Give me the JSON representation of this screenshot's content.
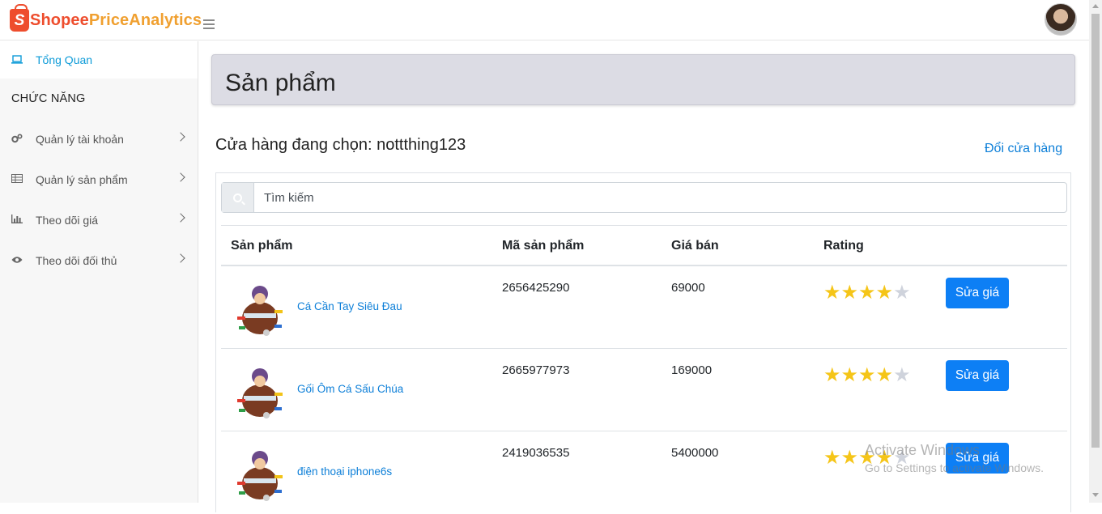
{
  "app": {
    "logo_part1": "Shopee",
    "logo_part2": "PriceAnalytics",
    "logo_letter": "S"
  },
  "sidebar": {
    "overview_label": "Tổng Quan",
    "section_header": "CHỨC NĂNG",
    "items": [
      {
        "label": "Quản lý tài khoản",
        "icon": "gears-icon"
      },
      {
        "label": "Quản lý sản phẩm",
        "icon": "table-icon"
      },
      {
        "label": "Theo dõi giá",
        "icon": "bar-chart-icon"
      },
      {
        "label": "Theo dõi đối thủ",
        "icon": "eye-icon"
      }
    ]
  },
  "main": {
    "page_title": "Sản phẩm",
    "store_label": "Cửa hàng đang chọn: nottthing123",
    "change_store": "Đổi cửa hàng",
    "search_placeholder": "Tìm kiếm",
    "columns": [
      "Sản phẩm",
      "Mã sản phẩm",
      "Giá bán",
      "Rating"
    ],
    "products": [
      {
        "name": "Cá Cần Tay Siêu Đau",
        "code": "2656425290",
        "price": "69000",
        "rating": 4,
        "button": "Sửa giá"
      },
      {
        "name": "Gối Ôm Cá Sấu Chúa",
        "code": "2665977973",
        "price": "169000",
        "rating": 4,
        "button": "Sửa giá"
      },
      {
        "name": "điện thoại iphone6s",
        "code": "2419036535",
        "price": "5400000",
        "rating": 4,
        "button": "Sửa giá"
      }
    ]
  },
  "watermark": {
    "line1": "Activate Windows",
    "line2": "Go to Settings to activate Windows."
  },
  "colors": {
    "brand": "#ee4d2d",
    "accent": "#0d7ff5",
    "star": "#f5c518"
  }
}
